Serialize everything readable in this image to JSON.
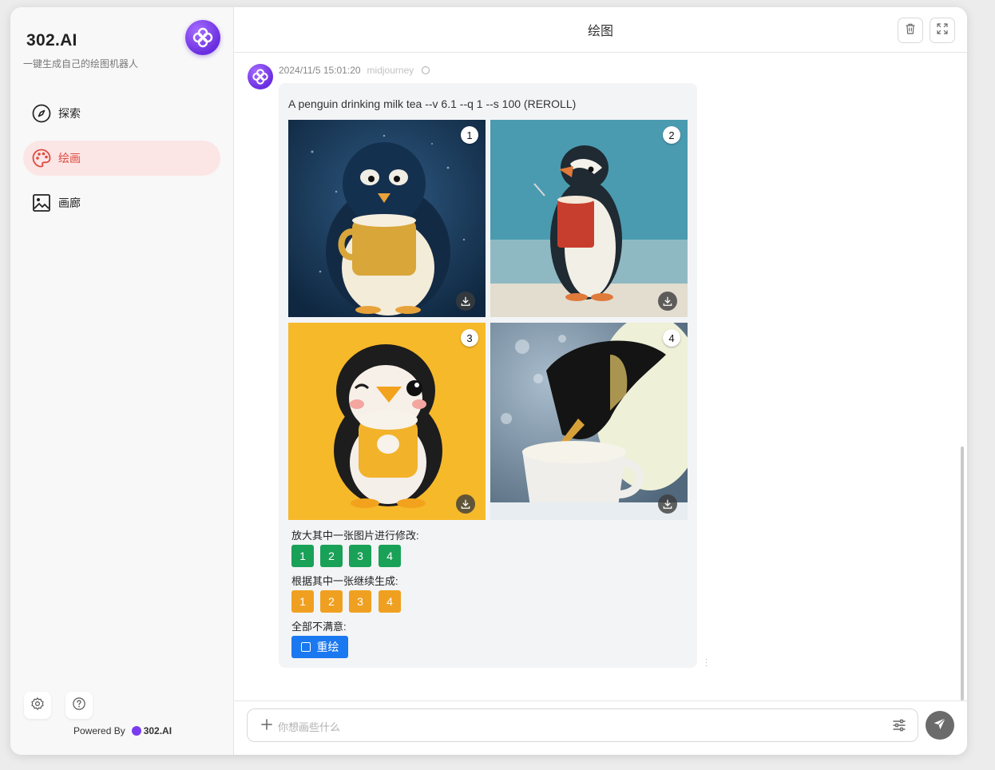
{
  "sidebar": {
    "brand_title": "302.AI",
    "brand_subtitle": "一键生成自己的绘图机器人",
    "nav": [
      {
        "label": "探索",
        "icon": "compass-icon",
        "active": false
      },
      {
        "label": "绘画",
        "icon": "palette-icon",
        "active": true
      },
      {
        "label": "画廊",
        "icon": "image-icon",
        "active": false
      }
    ],
    "powered_by": "Powered By",
    "powered_brand": "302.AI"
  },
  "header": {
    "title": "绘图"
  },
  "message": {
    "timestamp": "2024/11/5 15:01:20",
    "model": "midjourney",
    "prompt": "A penguin drinking milk tea --v 6.1 --q 1 --s 100 (REROLL)",
    "images": [
      {
        "index": "1"
      },
      {
        "index": "2"
      },
      {
        "index": "3"
      },
      {
        "index": "4"
      }
    ],
    "upscale_label": "放大其中一张图片进行修改:",
    "upscale_buttons": [
      "1",
      "2",
      "3",
      "4"
    ],
    "variation_label": "根据其中一张继续生成:",
    "variation_buttons": [
      "1",
      "2",
      "3",
      "4"
    ],
    "unsatisfied_label": "全部不满意:",
    "redraw_label": "重绘"
  },
  "input": {
    "placeholder": "你想画些什么"
  },
  "colors": {
    "accent_active": "#e04a3f",
    "active_bg": "#fbe5e5",
    "green": "#19a157",
    "orange": "#f0a020",
    "blue": "#1a78f0",
    "brand_purple": "#7a3cf0"
  }
}
